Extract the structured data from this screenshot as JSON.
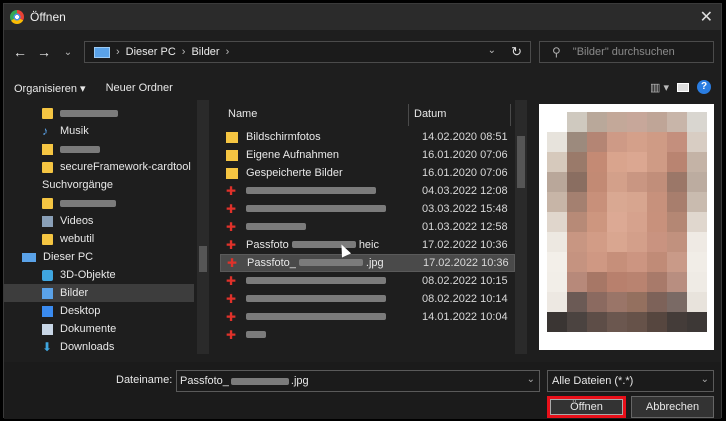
{
  "window": {
    "title": "Öffnen",
    "close_glyph": "✕"
  },
  "toolbar": {
    "back_glyph": "←",
    "forward_glyph": "→",
    "recent_glyph": "⌄",
    "up_glyph": "↑",
    "breadcrumb": [
      "Dieser PC",
      "Bilder"
    ],
    "separator": "›",
    "refresh_glyph": "↻",
    "dropdown_glyph": "⌄",
    "search_placeholder": "\"Bilder\" durchsuchen",
    "search_icon_glyph": "⚲"
  },
  "cmdbar": {
    "organize": "Organisieren ▾",
    "new_folder": "Neuer Ordner",
    "help": "?"
  },
  "nav": {
    "items": [
      {
        "label": "",
        "icon": "folder-icon",
        "blurred": true
      },
      {
        "label": "Musik",
        "icon": "music-icon"
      },
      {
        "label": "",
        "icon": "onedrive-folder-icon",
        "blurred": true
      },
      {
        "label": "secureFramework-cardtool",
        "icon": "folder-icon"
      },
      {
        "label": "Suchvorgänge",
        "icon": "search-folder-icon"
      },
      {
        "label": "",
        "icon": "folder-icon",
        "blurred": true
      },
      {
        "label": "Videos",
        "icon": "videos-icon"
      },
      {
        "label": "webutil",
        "icon": "folder-icon"
      },
      {
        "label": "Dieser PC",
        "icon": "pc-icon"
      },
      {
        "label": "3D-Objekte",
        "icon": "3d-objects-icon"
      },
      {
        "label": "Bilder",
        "icon": "pictures-icon",
        "selected": true
      },
      {
        "label": "Desktop",
        "icon": "desktop-icon"
      },
      {
        "label": "Dokumente",
        "icon": "documents-icon"
      },
      {
        "label": "Downloads",
        "icon": "downloads-icon"
      }
    ]
  },
  "files": {
    "columns": {
      "name": "Name",
      "date": "Datum"
    },
    "rows": [
      {
        "name": "Bildschirmfotos",
        "date": "14.02.2020 08:51",
        "type": "folder"
      },
      {
        "name": "Eigene Aufnahmen",
        "date": "16.01.2020 07:06",
        "type": "folder"
      },
      {
        "name": "Gespeicherte Bilder",
        "date": "16.01.2020 07:06",
        "type": "folder"
      },
      {
        "name": "",
        "date": "04.03.2022 12:08",
        "type": "image",
        "blurred": true
      },
      {
        "name": "",
        "date": "03.03.2022 15:48",
        "type": "image",
        "blurred": true
      },
      {
        "name": "",
        "date": "01.03.2022 12:58",
        "type": "image",
        "blurred": true
      },
      {
        "name": "Passfoto",
        "suffix": "heic",
        "date": "17.02.2022 10:36",
        "type": "image",
        "partial_blur": true
      },
      {
        "name": "Passfoto_",
        "suffix": ".jpg",
        "date": "17.02.2022 10:36",
        "type": "image",
        "partial_blur": true,
        "selected": true
      },
      {
        "name": "",
        "date": "08.02.2022 10:15",
        "type": "image",
        "blurred": true
      },
      {
        "name": "",
        "date": "08.02.2022 10:14",
        "type": "image",
        "blurred": true
      },
      {
        "name": "",
        "date": "14.01.2022 10:04",
        "type": "image",
        "blurred": true
      },
      {
        "name": "",
        "date": "",
        "type": "image",
        "blurred": true
      }
    ]
  },
  "bottom": {
    "filename_label": "Dateiname:",
    "filename_prefix": "Passfoto_",
    "filename_suffix": ".jpg",
    "filetype": "Alle Dateien (*.*)",
    "open_label": "Öffnen",
    "cancel_label": "Abbrechen"
  },
  "colors": {
    "preview_pixels": [
      "#ffffff",
      "#cfc9bf",
      "#b9a89a",
      "#c3a899",
      "#c7a79a",
      "#bfa597",
      "#c8b5a9",
      "#d9d6d0",
      "#e7e3dc",
      "#9c8a7d",
      "#b48574",
      "#ce9a86",
      "#d4a08a",
      "#cf9b85",
      "#c48f7d",
      "#d8cdc3",
      "#d6c9bc",
      "#9a7a6a",
      "#c48a74",
      "#d9a48d",
      "#dba791",
      "#cf9b85",
      "#b98471",
      "#c4b3a6",
      "#b9a79a",
      "#8a6e61",
      "#c28a74",
      "#d3a08a",
      "#c99682",
      "#c18e7a",
      "#9b7768",
      "#bcaca0",
      "#c7b5a7",
      "#a48070",
      "#c8907a",
      "#d9a892",
      "#d7a58f",
      "#c7917c",
      "#a87e6d",
      "#c9bbaf",
      "#e0d6cc",
      "#b78a77",
      "#cd967f",
      "#dca994",
      "#d6a28d",
      "#c8917c",
      "#b48774",
      "#e0d7ce",
      "#ede8e1",
      "#c89682",
      "#d29c86",
      "#d9a690",
      "#d39f8a",
      "#c99380",
      "#c1917e",
      "#efeae4",
      "#f3efe9",
      "#c59380",
      "#cf9883",
      "#c68f7a",
      "#cc9581",
      "#c08b77",
      "#c99a88",
      "#f1ede7",
      "#f2eee8",
      "#b7897a",
      "#a77766",
      "#b8806d",
      "#b98370",
      "#a87a6a",
      "#b88e80",
      "#efebe5",
      "#ede8e2",
      "#6b5a55",
      "#8b6a60",
      "#9a7568",
      "#94705f",
      "#7d6259",
      "#7a6a65",
      "#e8e3dc",
      "#3a3533",
      "#4b4340",
      "#5d4d47",
      "#6b574f",
      "#665249",
      "#56463f",
      "#443c39",
      "#3d3836"
    ]
  }
}
